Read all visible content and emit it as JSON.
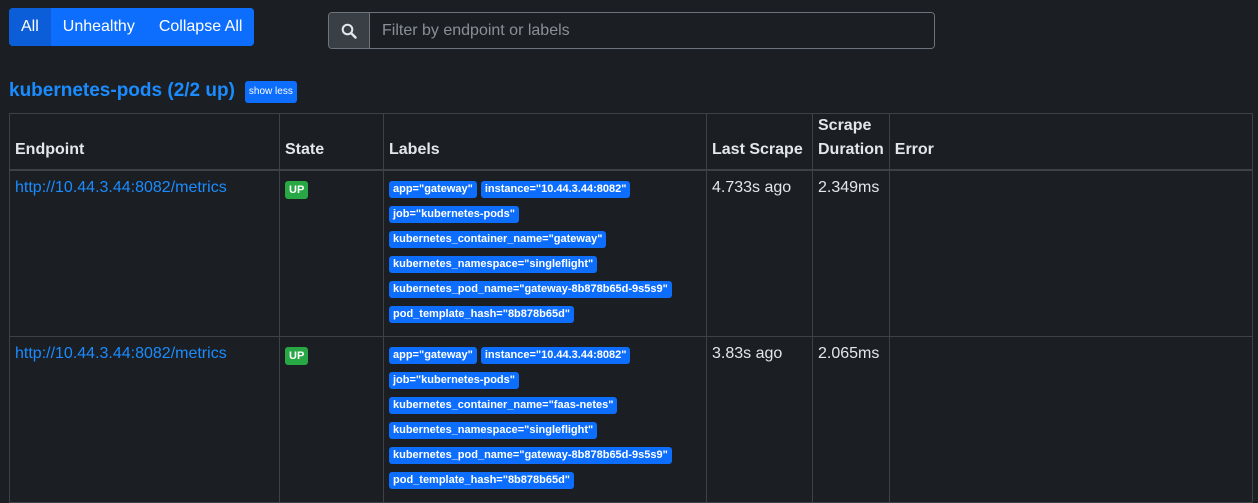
{
  "toolbar": {
    "buttons": [
      "All",
      "Unhealthy",
      "Collapse All"
    ],
    "active": "All"
  },
  "search": {
    "placeholder": "Filter by endpoint or labels",
    "icon": "search-icon"
  },
  "pool": {
    "title": "kubernetes-pods (2/2 up)",
    "toggle_label": "show less"
  },
  "table": {
    "headers": {
      "endpoint": "Endpoint",
      "state": "State",
      "labels": "Labels",
      "last_scrape": "Last Scrape",
      "scrape_duration": "Scrape Duration",
      "error": "Error"
    },
    "rows": [
      {
        "endpoint": "http://10.44.3.44:8082/metrics",
        "state": "UP",
        "labels": [
          "app=\"gateway\"",
          "instance=\"10.44.3.44:8082\"",
          "job=\"kubernetes-pods\"",
          "kubernetes_container_name=\"gateway\"",
          "kubernetes_namespace=\"singleflight\"",
          "kubernetes_pod_name=\"gateway-8b878b65d-9s5s9\"",
          "pod_template_hash=\"8b878b65d\""
        ],
        "last_scrape": "4.733s ago",
        "scrape_duration": "2.349ms",
        "error": ""
      },
      {
        "endpoint": "http://10.44.3.44:8082/metrics",
        "state": "UP",
        "labels": [
          "app=\"gateway\"",
          "instance=\"10.44.3.44:8082\"",
          "job=\"kubernetes-pods\"",
          "kubernetes_container_name=\"faas-netes\"",
          "kubernetes_namespace=\"singleflight\"",
          "kubernetes_pod_name=\"gateway-8b878b65d-9s5s9\"",
          "pod_template_hash=\"8b878b65d\""
        ],
        "last_scrape": "3.83s ago",
        "scrape_duration": "2.065ms",
        "error": ""
      }
    ]
  },
  "colors": {
    "background": "#1b1e23",
    "primary": "#0d6efd",
    "link": "#1a8cff",
    "success": "#28a745"
  }
}
